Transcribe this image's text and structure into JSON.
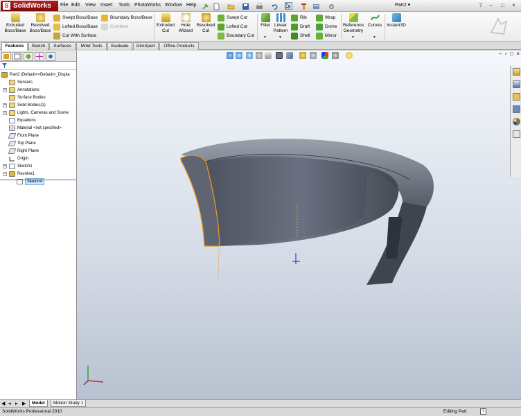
{
  "app": {
    "name": "SolidWorks",
    "document": "Part2"
  },
  "menu": [
    "File",
    "Edit",
    "View",
    "Insert",
    "Tools",
    "PhotoWorks",
    "Window",
    "Help"
  ],
  "window_controls": [
    "?",
    "–",
    "□",
    "×"
  ],
  "ribbon": {
    "extruded_boss": [
      "Extruded",
      "Boss/Base"
    ],
    "revolved_boss": [
      "Revolved",
      "Boss/Base"
    ],
    "swept_boss": "Swept Boss/Base",
    "lofted_boss": "Lofted Boss/Base",
    "cut_with_surface": "Cut With Surface",
    "boundary_boss": "Boundary Boss/Base",
    "combine": "Combine",
    "extruded_cut": [
      "Extruded",
      "Cut"
    ],
    "hole_wizard": [
      "Hole",
      "Wizard"
    ],
    "revolved_cut": [
      "Revolved",
      "Cut"
    ],
    "swept_cut": "Swept Cut",
    "lofted_cut": "Lofted Cut",
    "boundary_cut": "Boundary Cut",
    "fillet": "Fillet",
    "linear_pattern": [
      "Linear",
      "Pattern"
    ],
    "rib": "Rib",
    "draft": "Draft",
    "shell": "Shell",
    "wrap": "Wrap",
    "dome": "Dome",
    "mirror": "Mirror",
    "reference_geometry": [
      "Reference",
      "Geometry"
    ],
    "curves": "Curves",
    "instant3d": "Instant3D"
  },
  "tabs": [
    "Features",
    "Sketch",
    "Surfaces",
    "Mold Tools",
    "Evaluate",
    "DimXpert",
    "Office Products"
  ],
  "active_tab": "Features",
  "feature_tree": {
    "root": "Part2  (Default<<Default>_Displa",
    "items": [
      {
        "label": "Sensors",
        "icon": "sensor-icon"
      },
      {
        "label": "Annotations",
        "icon": "annotation-icon",
        "expandable": true
      },
      {
        "label": "Surface Bodies",
        "icon": "surface-bodies-icon"
      },
      {
        "label": "Solid Bodies(1)",
        "icon": "solid-bodies-icon",
        "expandable": true
      },
      {
        "label": "Lights, Cameras and Scene",
        "icon": "lights-icon",
        "expandable": true
      },
      {
        "label": "Equations",
        "icon": "equation-icon"
      },
      {
        "label": "Material <not specified>",
        "icon": "material-icon"
      },
      {
        "label": "Front Plane",
        "icon": "plane-icon"
      },
      {
        "label": "Top Plane",
        "icon": "plane-icon"
      },
      {
        "label": "Right Plane",
        "icon": "plane-icon"
      },
      {
        "label": "Origin",
        "icon": "origin-icon"
      },
      {
        "label": "Sketch1",
        "icon": "sketch-icon",
        "expandable": true
      },
      {
        "label": "Revolve1",
        "icon": "revolve-icon",
        "expandable": true,
        "expanded": true
      },
      {
        "label": "Sketch4",
        "icon": "sketch-icon",
        "selected": true
      }
    ]
  },
  "bottom_tabs": [
    "Model",
    "Motion Study 1"
  ],
  "status": {
    "product": "SolidWorks Professional 2010",
    "mode": "Editing Part",
    "help": "?"
  },
  "colors": {
    "model": "#5c6270",
    "edge_highlight": "#f0961e",
    "viewport_top": "#f4f7fb",
    "viewport_bottom": "#b8c1cf"
  }
}
